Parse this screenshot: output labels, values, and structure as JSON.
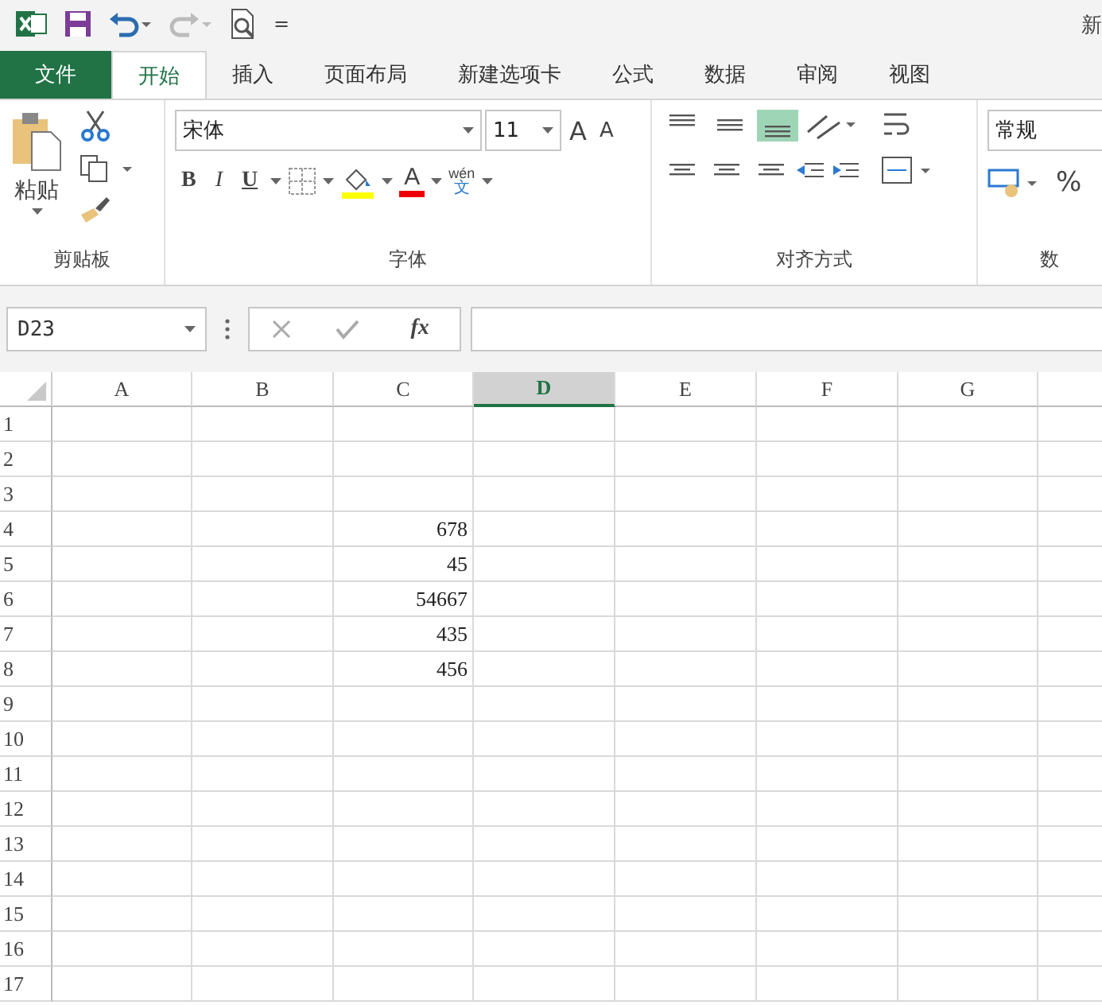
{
  "window": {
    "title": "新"
  },
  "quick_access": {
    "more": "="
  },
  "tabs": [
    {
      "label": "文件",
      "kind": "file",
      "selected": false
    },
    {
      "label": "开始",
      "kind": "tab",
      "selected": true
    },
    {
      "label": "插入",
      "kind": "tab",
      "selected": false
    },
    {
      "label": "页面布局",
      "kind": "tab",
      "selected": false
    },
    {
      "label": "新建选项卡",
      "kind": "tab",
      "selected": false
    },
    {
      "label": "公式",
      "kind": "tab",
      "selected": false
    },
    {
      "label": "数据",
      "kind": "tab",
      "selected": false
    },
    {
      "label": "审阅",
      "kind": "tab",
      "selected": false
    },
    {
      "label": "视图",
      "kind": "tab",
      "selected": false
    }
  ],
  "ribbon": {
    "clipboard": {
      "paste": "粘贴",
      "label": "剪贴板"
    },
    "font": {
      "name": "宋体",
      "size": "11",
      "grow": "A",
      "shrink": "A",
      "bold": "B",
      "italic": "I",
      "underline": "U",
      "font_color": "A",
      "phonetic_top": "wén",
      "phonetic_bottom": "文",
      "label": "字体"
    },
    "alignment": {
      "label": "对齐方式",
      "vertical": [
        {
          "selected": false
        },
        {
          "selected": false
        },
        {
          "selected": true
        }
      ]
    },
    "number": {
      "format": "常规",
      "percent": "%",
      "label": "数"
    }
  },
  "formula_bar": {
    "name_box": "D23",
    "fx": "fx"
  },
  "sheet": {
    "columns": [
      {
        "label": "A",
        "selected": false
      },
      {
        "label": "B",
        "selected": false
      },
      {
        "label": "C",
        "selected": false
      },
      {
        "label": "D",
        "selected": true
      },
      {
        "label": "E",
        "selected": false
      },
      {
        "label": "F",
        "selected": false
      },
      {
        "label": "G",
        "selected": false
      }
    ],
    "rows": [
      {
        "label": "1",
        "cells": {}
      },
      {
        "label": "2",
        "cells": {}
      },
      {
        "label": "3",
        "cells": {}
      },
      {
        "label": "4",
        "cells": {
          "C": "678"
        }
      },
      {
        "label": "5",
        "cells": {
          "C": "45"
        }
      },
      {
        "label": "6",
        "cells": {
          "C": "54667"
        }
      },
      {
        "label": "7",
        "cells": {
          "C": "435"
        }
      },
      {
        "label": "8",
        "cells": {
          "C": "456"
        }
      },
      {
        "label": "9",
        "cells": {}
      },
      {
        "label": "10",
        "cells": {}
      },
      {
        "label": "11",
        "cells": {}
      },
      {
        "label": "12",
        "cells": {}
      },
      {
        "label": "13",
        "cells": {}
      },
      {
        "label": "14",
        "cells": {}
      },
      {
        "label": "15",
        "cells": {}
      },
      {
        "label": "16",
        "cells": {}
      },
      {
        "label": "17",
        "cells": {}
      }
    ]
  }
}
